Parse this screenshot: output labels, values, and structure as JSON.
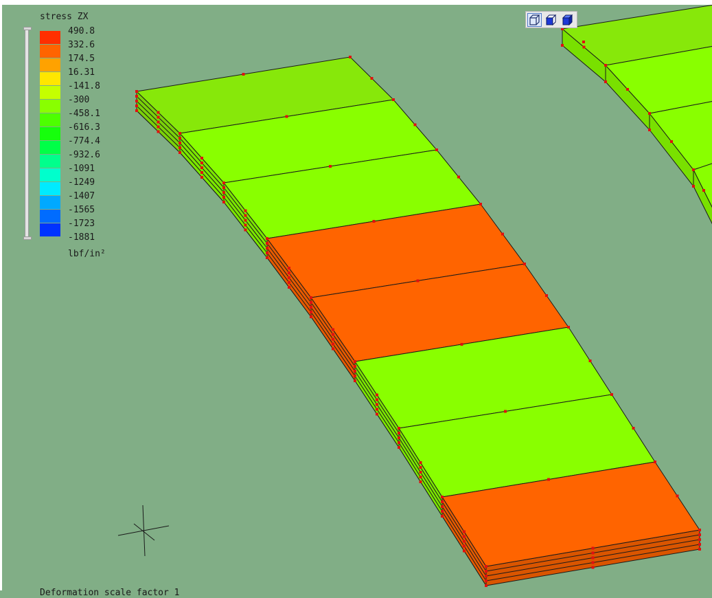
{
  "legend": {
    "title": "stress ZX",
    "unit": "lbf/in²",
    "entries": [
      {
        "value": "490.8",
        "color": "#ff2f00"
      },
      {
        "value": "332.6",
        "color": "#ff6400"
      },
      {
        "value": "174.5",
        "color": "#ffa200"
      },
      {
        "value": "16.31",
        "color": "#ffe600"
      },
      {
        "value": "-141.8",
        "color": "#c5ff00"
      },
      {
        "value": "-300",
        "color": "#89ff00"
      },
      {
        "value": "-458.1",
        "color": "#4dff00"
      },
      {
        "value": "-616.3",
        "color": "#16ff0c"
      },
      {
        "value": "-774.4",
        "color": "#00ff47"
      },
      {
        "value": "-932.6",
        "color": "#00ff8c"
      },
      {
        "value": "-1091",
        "color": "#00ffcc"
      },
      {
        "value": "-1249",
        "color": "#00ebff"
      },
      {
        "value": "-1407",
        "color": "#00a9ff"
      },
      {
        "value": "-1565",
        "color": "#006cff"
      },
      {
        "value": "-1723",
        "color": "#0033ff"
      }
    ],
    "min_value": "-1881"
  },
  "view_toolbar": {
    "buttons": [
      {
        "icon": "wireframe-cube-icon",
        "selected": true
      },
      {
        "icon": "shaded-cube-icon",
        "selected": false
      },
      {
        "icon": "solid-cube-icon",
        "selected": false
      }
    ]
  },
  "model": {
    "beam_elements": [
      {
        "stress_color": "#87e80a"
      },
      {
        "stress_color": "#89ff00"
      },
      {
        "stress_color": "#89ff00"
      },
      {
        "stress_color": "#ff6400"
      },
      {
        "stress_color": "#ff6400"
      },
      {
        "stress_color": "#89ff00"
      },
      {
        "stress_color": "#89ff00"
      },
      {
        "stress_color": "#ff6400"
      }
    ],
    "background_color": "#81ae86",
    "edge_color": "#1a1a1a",
    "node_marker_color": "#e01010"
  },
  "status": {
    "deformation_text": "Deformation scale factor 1"
  }
}
